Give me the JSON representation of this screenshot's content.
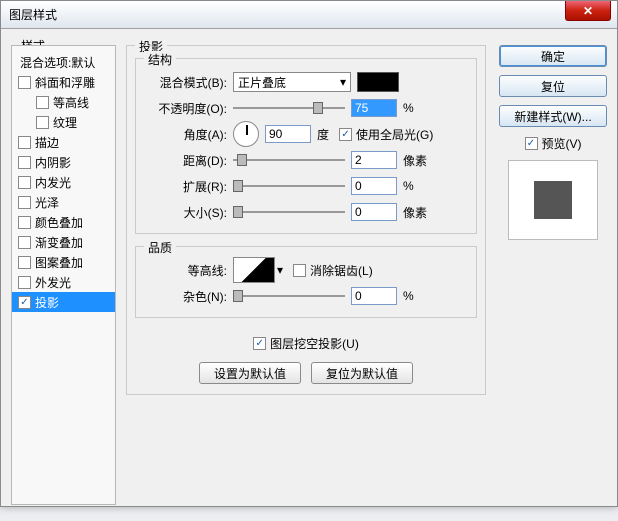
{
  "window": {
    "title": "图层样式"
  },
  "left": {
    "header": "样式",
    "blend": "混合选项:默认",
    "items": [
      {
        "label": "斜面和浮雕",
        "checked": false,
        "sub": false
      },
      {
        "label": "等高线",
        "checked": false,
        "sub": true
      },
      {
        "label": "纹理",
        "checked": false,
        "sub": true
      },
      {
        "label": "描边",
        "checked": false,
        "sub": false
      },
      {
        "label": "内阴影",
        "checked": false,
        "sub": false
      },
      {
        "label": "内发光",
        "checked": false,
        "sub": false
      },
      {
        "label": "光泽",
        "checked": false,
        "sub": false
      },
      {
        "label": "颜色叠加",
        "checked": false,
        "sub": false
      },
      {
        "label": "渐变叠加",
        "checked": false,
        "sub": false
      },
      {
        "label": "图案叠加",
        "checked": false,
        "sub": false
      },
      {
        "label": "外发光",
        "checked": false,
        "sub": false
      },
      {
        "label": "投影",
        "checked": true,
        "sub": false,
        "selected": true
      }
    ]
  },
  "main": {
    "panel_title": "投影",
    "group1": {
      "title": "结构",
      "blend_mode_label": "混合模式(B):",
      "blend_mode_value": "正片叠底",
      "opacity_label": "不透明度(O):",
      "opacity_value": "75",
      "opacity_unit": "%",
      "angle_label": "角度(A):",
      "angle_value": "90",
      "angle_unit": "度",
      "global_light": "使用全局光(G)",
      "global_light_checked": true,
      "distance_label": "距离(D):",
      "distance_value": "2",
      "distance_unit": "像素",
      "spread_label": "扩展(R):",
      "spread_value": "0",
      "spread_unit": "%",
      "size_label": "大小(S):",
      "size_value": "0",
      "size_unit": "像素"
    },
    "group2": {
      "title": "品质",
      "contour_label": "等高线:",
      "antialias": "消除锯齿(L)",
      "antialias_checked": false,
      "noise_label": "杂色(N):",
      "noise_value": "0",
      "noise_unit": "%"
    },
    "knockout": "图层挖空投影(U)",
    "knockout_checked": true,
    "reset_default": "设置为默认值",
    "restore_default": "复位为默认值"
  },
  "right": {
    "ok": "确定",
    "cancel": "复位",
    "new_style": "新建样式(W)...",
    "preview": "预览(V)",
    "preview_checked": true
  }
}
